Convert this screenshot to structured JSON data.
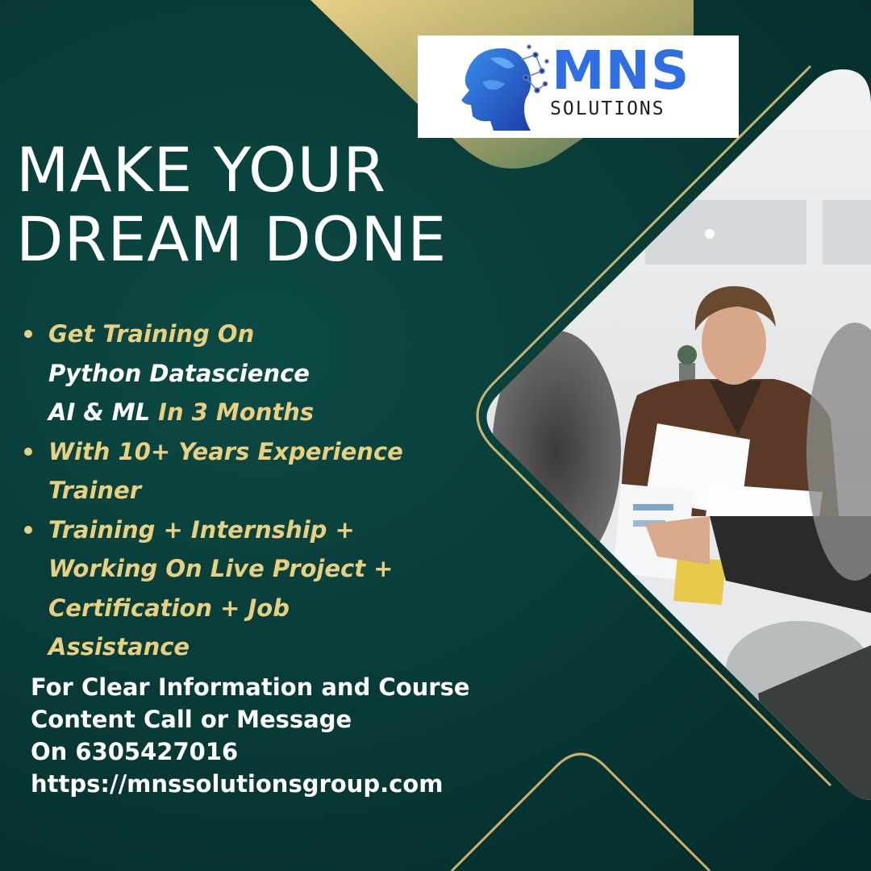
{
  "brand": {
    "name": "MNS",
    "subtitle": "SOLUTIONS"
  },
  "headline": {
    "line1": "MAKE YOUR",
    "line2": "DREAM DONE"
  },
  "bullets": [
    {
      "lines": [
        [
          {
            "text": "Get Training On",
            "accent": true
          }
        ],
        [
          {
            "text": "Python Datascience",
            "accent": false
          }
        ],
        [
          {
            "text": "AI &  ML ",
            "accent": false
          },
          {
            "text": "In 3 Months",
            "accent": true
          }
        ]
      ]
    },
    {
      "lines": [
        [
          {
            "text": "With 10+ Years Experience",
            "accent": true
          }
        ],
        [
          {
            "text": "Trainer",
            "accent": true
          }
        ]
      ]
    },
    {
      "lines": [
        [
          {
            "text": "Training + Internship +",
            "accent": true
          }
        ],
        [
          {
            "text": "Working On Live Project +",
            "accent": true
          }
        ],
        [
          {
            "text": "Certification + Job",
            "accent": true
          }
        ],
        [
          {
            "text": "Assistance",
            "accent": true
          }
        ]
      ]
    }
  ],
  "contact": {
    "line1": "For Clear Information and Course",
    "line2": "Content Call or Message",
    "line3": "On 6305427016",
    "line4": "https://mnssolutionsgroup.com"
  },
  "colors": {
    "background": "#083c38",
    "accent_gold": "#e9cf80",
    "logo_blue": "#2f6fe4",
    "text_white": "#ffffff"
  },
  "icons": {
    "logo": "ai-head-icon",
    "bullet": "bullet-dot-icon"
  },
  "photo": {
    "subject": "office-meeting-photo"
  }
}
